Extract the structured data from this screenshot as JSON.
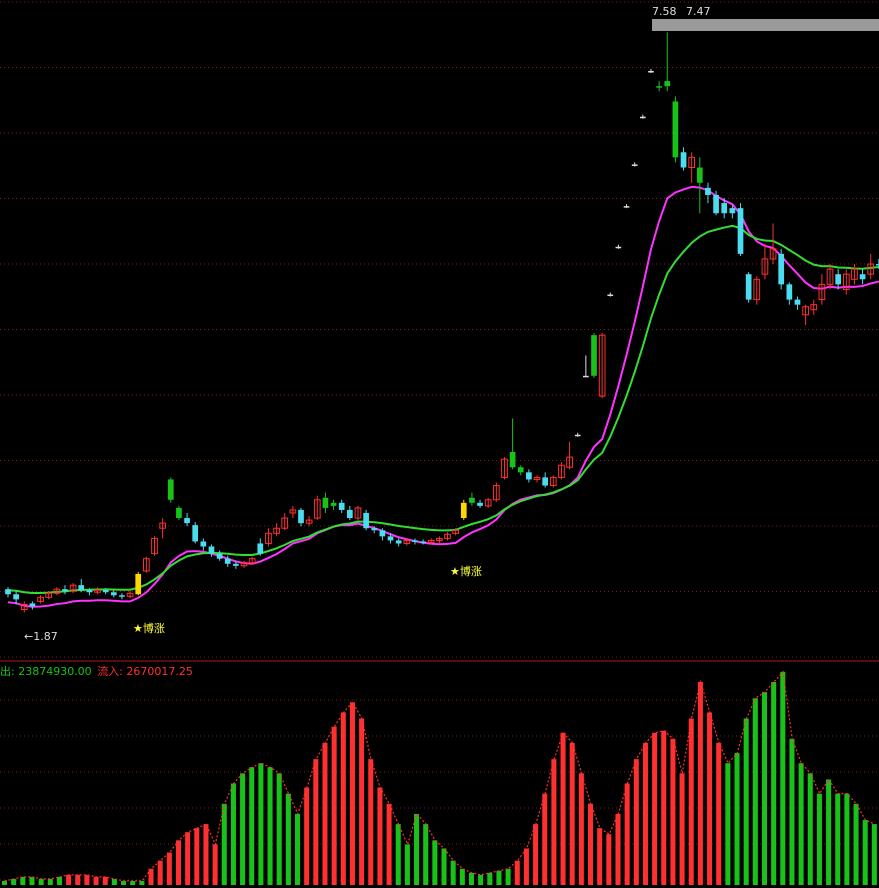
{
  "colors": {
    "background": "#000000",
    "grid": "#7a1a1a",
    "divider": "#b01818",
    "up": "#ff3030",
    "down_green": "#19c219",
    "down_cyan": "#4cdcf0",
    "signal": "#ffd700",
    "band_upper": "#ff33ff",
    "band_outer": "#33dd33",
    "star_label": "#ffff33",
    "text_white": "#dddddd",
    "gray_bar": "#9a9a9a",
    "inflow_text": "#ff3030",
    "outflow_text": "#19c219"
  },
  "labels": {
    "low_price": "←1.87",
    "high_price": "7.58",
    "high_price2": "7.47",
    "star1": "★博涨",
    "star2": "★博涨",
    "outflow_label": "出: 23874930.00",
    "inflow_label": "流入: 2670017.25"
  },
  "chart_data": [
    {
      "type": "candlestick",
      "title": "",
      "price_range": [
        1.6,
        7.8
      ],
      "annotations": [
        {
          "text": "←1.87",
          "at_index": 2,
          "value": 1.87
        },
        {
          "text": "7.58",
          "at_index": 81,
          "value": 7.58
        },
        {
          "text": "7.47",
          "at_index": 84,
          "value": 7.47
        },
        {
          "text": "★博涨",
          "at_index": 16
        },
        {
          "text": "★博涨",
          "at_index": 56
        }
      ],
      "candles": [
        [
          2.1,
          2.05,
          2.12,
          2.02,
          "c"
        ],
        [
          2.05,
          2.0,
          2.08,
          1.95,
          "c"
        ],
        [
          1.95,
          1.9,
          1.98,
          1.87,
          "u"
        ],
        [
          1.93,
          1.96,
          1.98,
          1.9,
          "c"
        ],
        [
          1.98,
          2.02,
          2.04,
          1.96,
          "u"
        ],
        [
          2.02,
          2.06,
          2.08,
          2.0,
          "u"
        ],
        [
          2.06,
          2.1,
          2.12,
          2.04,
          "u"
        ],
        [
          2.1,
          2.08,
          2.14,
          2.05,
          "c"
        ],
        [
          2.08,
          2.14,
          2.16,
          2.06,
          "u"
        ],
        [
          2.14,
          2.09,
          2.2,
          2.07,
          "c"
        ],
        [
          2.09,
          2.07,
          2.11,
          2.04,
          "c"
        ],
        [
          2.07,
          2.09,
          2.12,
          2.05,
          "u"
        ],
        [
          2.09,
          2.07,
          2.11,
          2.05,
          "c"
        ],
        [
          2.07,
          2.04,
          2.09,
          2.02,
          "c"
        ],
        [
          2.04,
          2.03,
          2.06,
          2.0,
          "c"
        ],
        [
          2.03,
          2.06,
          2.08,
          2.01,
          "u"
        ],
        [
          2.05,
          2.25,
          2.27,
          2.04,
          "s"
        ],
        [
          2.28,
          2.4,
          2.42,
          2.26,
          "u"
        ],
        [
          2.45,
          2.6,
          2.62,
          2.43,
          "u"
        ],
        [
          2.7,
          2.75,
          2.8,
          2.6,
          "u"
        ],
        [
          3.18,
          2.98,
          3.2,
          2.95,
          "g"
        ],
        [
          2.9,
          2.8,
          2.92,
          2.78,
          "g"
        ],
        [
          2.8,
          2.75,
          2.85,
          2.72,
          "c"
        ],
        [
          2.73,
          2.57,
          2.76,
          2.55,
          "c"
        ],
        [
          2.57,
          2.52,
          2.6,
          2.48,
          "c"
        ],
        [
          2.52,
          2.45,
          2.54,
          2.42,
          "c"
        ],
        [
          2.45,
          2.4,
          2.48,
          2.38,
          "c"
        ],
        [
          2.4,
          2.35,
          2.43,
          2.32,
          "c"
        ],
        [
          2.35,
          2.33,
          2.38,
          2.3,
          "c"
        ],
        [
          2.33,
          2.36,
          2.38,
          2.31,
          "u"
        ],
        [
          2.36,
          2.4,
          2.42,
          2.34,
          "u"
        ],
        [
          2.45,
          2.55,
          2.6,
          2.43,
          "c"
        ],
        [
          2.55,
          2.65,
          2.7,
          2.52,
          "u"
        ],
        [
          2.65,
          2.7,
          2.75,
          2.62,
          "u"
        ],
        [
          2.7,
          2.8,
          2.85,
          2.68,
          "u"
        ],
        [
          2.85,
          2.88,
          2.92,
          2.8,
          "u"
        ],
        [
          2.88,
          2.75,
          2.9,
          2.72,
          "c"
        ],
        [
          2.75,
          2.78,
          2.82,
          2.72,
          "u"
        ],
        [
          2.8,
          2.98,
          3.02,
          2.78,
          "u"
        ],
        [
          3.0,
          2.9,
          3.05,
          2.85,
          "g"
        ],
        [
          2.92,
          2.95,
          2.98,
          2.88,
          "g"
        ],
        [
          2.95,
          2.88,
          2.98,
          2.85,
          "c"
        ],
        [
          2.88,
          2.8,
          2.92,
          2.78,
          "c"
        ],
        [
          2.8,
          2.9,
          2.92,
          2.78,
          "u"
        ],
        [
          2.85,
          2.7,
          2.88,
          2.68,
          "c"
        ],
        [
          2.7,
          2.68,
          2.72,
          2.65,
          "c"
        ],
        [
          2.68,
          2.62,
          2.7,
          2.58,
          "c"
        ],
        [
          2.62,
          2.58,
          2.65,
          2.55,
          "c"
        ],
        [
          2.58,
          2.55,
          2.6,
          2.52,
          "c"
        ],
        [
          2.55,
          2.58,
          2.6,
          2.53,
          "u"
        ],
        [
          2.58,
          2.57,
          2.6,
          2.54,
          "c"
        ],
        [
          2.57,
          2.56,
          2.59,
          2.54,
          "c"
        ],
        [
          2.56,
          2.58,
          2.6,
          2.54,
          "u"
        ],
        [
          2.58,
          2.6,
          2.62,
          2.55,
          "u"
        ],
        [
          2.6,
          2.64,
          2.66,
          2.58,
          "u"
        ],
        [
          2.65,
          2.68,
          2.7,
          2.63,
          "u"
        ],
        [
          2.8,
          2.95,
          2.98,
          2.78,
          "s"
        ],
        [
          3.0,
          2.95,
          3.05,
          2.92,
          "g"
        ],
        [
          2.95,
          2.92,
          2.98,
          2.9,
          "c"
        ],
        [
          2.92,
          2.98,
          3.0,
          2.9,
          "u"
        ],
        [
          2.98,
          3.12,
          3.15,
          2.96,
          "u"
        ],
        [
          3.2,
          3.38,
          3.4,
          3.18,
          "u"
        ],
        [
          3.45,
          3.3,
          3.78,
          3.28,
          "g"
        ],
        [
          3.3,
          3.25,
          3.32,
          3.22,
          "g"
        ],
        [
          3.25,
          3.18,
          3.28,
          3.15,
          "c"
        ],
        [
          3.18,
          3.2,
          3.22,
          3.15,
          "u"
        ],
        [
          3.2,
          3.12,
          3.25,
          3.1,
          "c"
        ],
        [
          3.12,
          3.2,
          3.22,
          3.1,
          "u"
        ],
        [
          3.2,
          3.32,
          3.35,
          3.18,
          "u"
        ],
        [
          3.3,
          3.4,
          3.55,
          3.28,
          "u"
        ],
        [
          3.62,
          3.62,
          3.64,
          3.6,
          "w"
        ],
        [
          4.2,
          4.2,
          4.4,
          4.2,
          "w"
        ],
        [
          4.6,
          4.2,
          4.62,
          4.18,
          "g"
        ],
        [
          4.6,
          4.0,
          4.62,
          3.98,
          "u"
        ],
        [
          5.0,
          5.0,
          5.02,
          4.98,
          "w"
        ],
        [
          5.47,
          5.47,
          5.49,
          5.45,
          "w"
        ],
        [
          5.87,
          5.87,
          5.89,
          5.85,
          "w"
        ],
        [
          6.28,
          6.28,
          6.3,
          6.26,
          "w"
        ],
        [
          6.75,
          6.75,
          6.77,
          6.73,
          "w"
        ],
        [
          7.2,
          7.2,
          7.22,
          7.18,
          "w"
        ],
        [
          7.05,
          7.05,
          7.1,
          7.0,
          "g"
        ],
        [
          7.1,
          7.05,
          7.58,
          7.0,
          "g"
        ],
        [
          6.9,
          6.35,
          6.95,
          6.3,
          "g"
        ],
        [
          6.4,
          6.25,
          6.45,
          6.22,
          "c"
        ],
        [
          6.35,
          6.25,
          6.4,
          6.1,
          "u"
        ],
        [
          6.25,
          6.1,
          6.35,
          5.8,
          "g"
        ],
        [
          6.05,
          5.98,
          6.1,
          5.9,
          "c"
        ],
        [
          5.98,
          5.8,
          6.02,
          5.78,
          "c"
        ],
        [
          5.9,
          5.8,
          5.95,
          5.75,
          "c"
        ],
        [
          5.85,
          5.8,
          5.88,
          5.75,
          "c"
        ],
        [
          5.85,
          5.4,
          5.9,
          5.38,
          "c"
        ],
        [
          5.2,
          4.95,
          5.22,
          4.92,
          "c"
        ],
        [
          4.95,
          5.15,
          5.18,
          4.9,
          "u"
        ],
        [
          5.2,
          5.35,
          5.5,
          5.15,
          "u"
        ],
        [
          5.35,
          5.45,
          5.7,
          5.3,
          "u"
        ],
        [
          5.4,
          5.1,
          5.45,
          5.05,
          "c"
        ],
        [
          5.1,
          4.95,
          5.12,
          4.9,
          "c"
        ],
        [
          4.95,
          4.9,
          4.98,
          4.85,
          "c"
        ],
        [
          4.88,
          4.8,
          4.9,
          4.7,
          "u"
        ],
        [
          4.85,
          4.9,
          4.95,
          4.8,
          "u"
        ],
        [
          4.95,
          5.1,
          5.2,
          4.9,
          "u"
        ],
        [
          5.1,
          5.25,
          5.3,
          5.05,
          "u"
        ],
        [
          5.2,
          5.1,
          5.25,
          5.05,
          "c"
        ],
        [
          5.05,
          5.2,
          5.25,
          5.0,
          "u"
        ],
        [
          5.25,
          5.15,
          5.3,
          5.1,
          "u"
        ],
        [
          5.15,
          5.2,
          5.25,
          5.1,
          "c"
        ],
        [
          5.2,
          5.3,
          5.4,
          5.15,
          "u"
        ],
        [
          5.3,
          5.3,
          5.35,
          5.25,
          "c"
        ]
      ]
    },
    {
      "type": "bar",
      "title": "",
      "value_range": [
        0,
        100
      ],
      "outflow_total": 23874930.0,
      "inflow_total": 2670017.25,
      "bars": [
        [
          0.02,
          "g"
        ],
        [
          0.03,
          "g"
        ],
        [
          0.04,
          "g"
        ],
        [
          0.04,
          "g"
        ],
        [
          0.03,
          "g"
        ],
        [
          0.03,
          "g"
        ],
        [
          0.04,
          "g"
        ],
        [
          0.05,
          "r"
        ],
        [
          0.05,
          "r"
        ],
        [
          0.05,
          "r"
        ],
        [
          0.04,
          "r"
        ],
        [
          0.04,
          "r"
        ],
        [
          0.03,
          "g"
        ],
        [
          0.02,
          "g"
        ],
        [
          0.02,
          "g"
        ],
        [
          0.02,
          "g"
        ],
        [
          0.08,
          "r"
        ],
        [
          0.12,
          "r"
        ],
        [
          0.16,
          "r"
        ],
        [
          0.22,
          "r"
        ],
        [
          0.26,
          "r"
        ],
        [
          0.28,
          "r"
        ],
        [
          0.3,
          "r"
        ],
        [
          0.2,
          "r"
        ],
        [
          0.4,
          "g"
        ],
        [
          0.5,
          "g"
        ],
        [
          0.55,
          "g"
        ],
        [
          0.58,
          "g"
        ],
        [
          0.6,
          "g"
        ],
        [
          0.58,
          "g"
        ],
        [
          0.55,
          "g"
        ],
        [
          0.45,
          "g"
        ],
        [
          0.35,
          "g"
        ],
        [
          0.48,
          "r"
        ],
        [
          0.62,
          "r"
        ],
        [
          0.7,
          "r"
        ],
        [
          0.78,
          "r"
        ],
        [
          0.85,
          "r"
        ],
        [
          0.9,
          "r"
        ],
        [
          0.82,
          "r"
        ],
        [
          0.62,
          "r"
        ],
        [
          0.48,
          "r"
        ],
        [
          0.4,
          "r"
        ],
        [
          0.3,
          "g"
        ],
        [
          0.2,
          "g"
        ],
        [
          0.35,
          "g"
        ],
        [
          0.3,
          "g"
        ],
        [
          0.22,
          "g"
        ],
        [
          0.18,
          "g"
        ],
        [
          0.12,
          "g"
        ],
        [
          0.08,
          "g"
        ],
        [
          0.06,
          "g"
        ],
        [
          0.05,
          "g"
        ],
        [
          0.06,
          "g"
        ],
        [
          0.07,
          "g"
        ],
        [
          0.08,
          "g"
        ],
        [
          0.12,
          "r"
        ],
        [
          0.18,
          "r"
        ],
        [
          0.3,
          "r"
        ],
        [
          0.45,
          "r"
        ],
        [
          0.62,
          "r"
        ],
        [
          0.75,
          "r"
        ],
        [
          0.7,
          "r"
        ],
        [
          0.55,
          "r"
        ],
        [
          0.4,
          "r"
        ],
        [
          0.28,
          "r"
        ],
        [
          0.25,
          "r"
        ],
        [
          0.35,
          "r"
        ],
        [
          0.5,
          "r"
        ],
        [
          0.62,
          "r"
        ],
        [
          0.7,
          "r"
        ],
        [
          0.75,
          "r"
        ],
        [
          0.76,
          "r"
        ],
        [
          0.72,
          "r"
        ],
        [
          0.55,
          "r"
        ],
        [
          0.82,
          "r"
        ],
        [
          1.0,
          "r"
        ],
        [
          0.85,
          "r"
        ],
        [
          0.7,
          "r"
        ],
        [
          0.6,
          "g"
        ],
        [
          0.65,
          "g"
        ],
        [
          0.82,
          "g"
        ],
        [
          0.92,
          "g"
        ],
        [
          0.95,
          "g"
        ],
        [
          1.0,
          "g"
        ],
        [
          1.05,
          "g"
        ],
        [
          0.72,
          "g"
        ],
        [
          0.6,
          "g"
        ],
        [
          0.55,
          "g"
        ],
        [
          0.45,
          "g"
        ],
        [
          0.52,
          "g"
        ],
        [
          0.45,
          "g"
        ],
        [
          0.45,
          "g"
        ],
        [
          0.4,
          "g"
        ],
        [
          0.32,
          "g"
        ],
        [
          0.3,
          "g"
        ]
      ]
    }
  ]
}
